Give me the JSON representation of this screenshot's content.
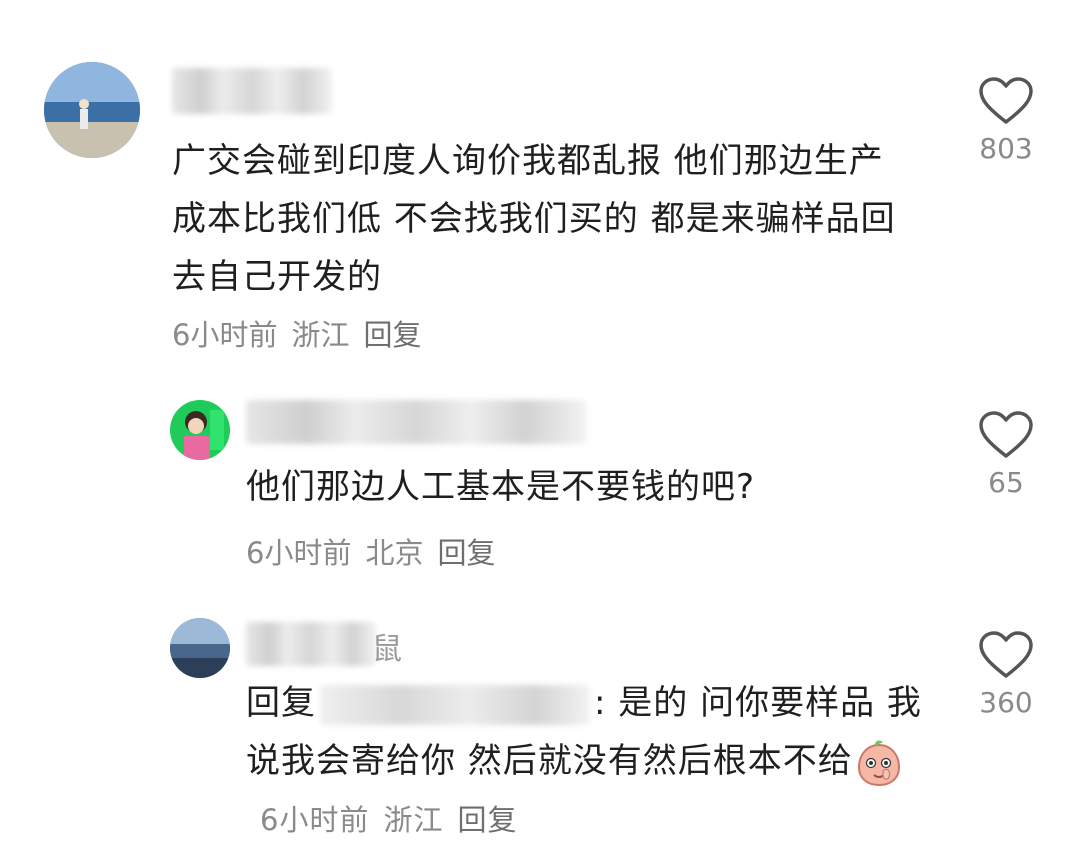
{
  "comments": [
    {
      "text": "广交会碰到印度人询价我都乱报 他们那边生产成本比我们低 不会找我们买的 都是来骗样品回去自己开发的",
      "time": "6小时前",
      "location": "浙江",
      "reply_label": "回复",
      "likes": "803",
      "icons": {
        "avatar": "avatar",
        "like": "heart-outline-icon"
      }
    },
    {
      "text": "他们那边人工基本是不要钱的吧?",
      "time": "6小时前",
      "location": "北京",
      "reply_label": "回复",
      "likes": "65",
      "icons": {
        "avatar": "avatar",
        "like": "heart-outline-icon"
      }
    },
    {
      "username_partial": "鼠",
      "reply_prefix": "回复",
      "text_after": ":  是的 问你要样品 我说我会寄给你 然后就没有然后根本不给",
      "time": "6小时前",
      "location": "浙江",
      "reply_label": "回复",
      "likes": "360",
      "icons": {
        "avatar": "avatar",
        "like": "heart-outline-icon",
        "emoji": "peach-emoji-icon"
      }
    }
  ],
  "colors": {
    "text": "#1f1f1f",
    "meta": "#8a8a8a",
    "heart": "#555555"
  }
}
